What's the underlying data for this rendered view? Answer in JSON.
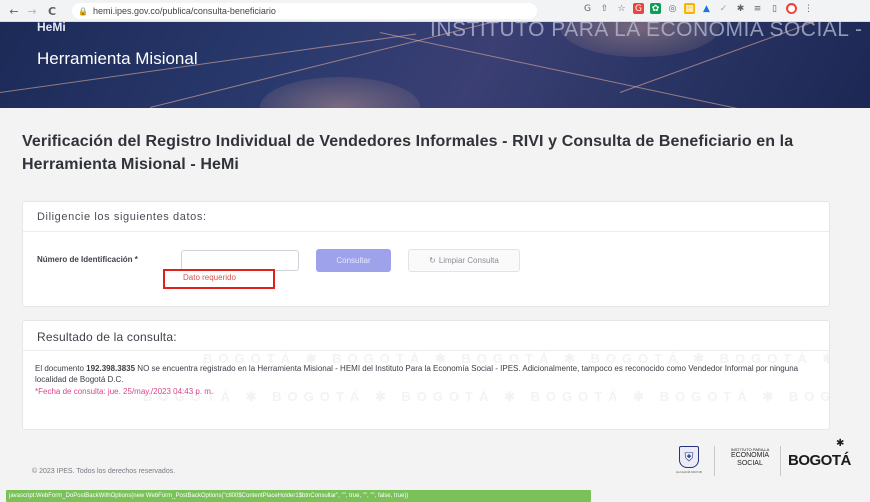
{
  "browser": {
    "back_icon": "←",
    "forward_icon": "→",
    "reload_icon": "C",
    "url": "hemi.ipes.gov.co/publica/consulta-beneficiario"
  },
  "hero": {
    "logo_text": "HeMi",
    "app_name": "Herramienta Misional",
    "institution_watermark": "INSTITUTO PARA LA ECONOMÍA SOCIAL - IPES"
  },
  "page": {
    "title": "Verificación del Registro Individual de Vendedores Informales - RIVI y Consulta de Beneficiario en la Herramienta Misional - HeMi"
  },
  "form": {
    "header": "Diligencie los siguientes datos:",
    "id_label": "Número de Identificación *",
    "id_value": "",
    "error": "Dato requerido",
    "consult_button": "Consultar",
    "clear_button": "Limpiar Consulta"
  },
  "result": {
    "header": "Resultado de la consulta:",
    "text_prefix": "El documento ",
    "document_number": "192.398.3835",
    "text_suffix": " NO se encuentra registrado en la Herramienta Misional - HEMI del Instituto Para la Economía Social - IPES. Adicionalmente, tampoco es reconocido como Vendedor Informal por ninguna localidad de Bogotá D.C.",
    "date": "*Fecha de consulta: jue. 25/may./2023 04:43 p. m."
  },
  "footer": {
    "copyright": "© 2023 IPES. Todos los derechos reservados.",
    "status_bar": "javascript:WebForm_DoPostBackWithOptions(new WebForm_PostBackOptions(\"ctl00$ContentPlaceHolder1$btnConsultar\", \"\", true, \"\", \"\", false, true))",
    "logo_ipes_top": "INSTITUTO PARA LA",
    "logo_ipes_mid": "ECONOMÍA",
    "logo_ipes_bot": "SOCIAL",
    "logo_city": "BOGOTÁ",
    "logo_escudo_caption": "ALCALDÍA MAYOR"
  },
  "colors": {
    "accent": "#9ea2eb",
    "error": "#e0201b",
    "date": "#d9478a",
    "hero": "#2b3a6e"
  }
}
